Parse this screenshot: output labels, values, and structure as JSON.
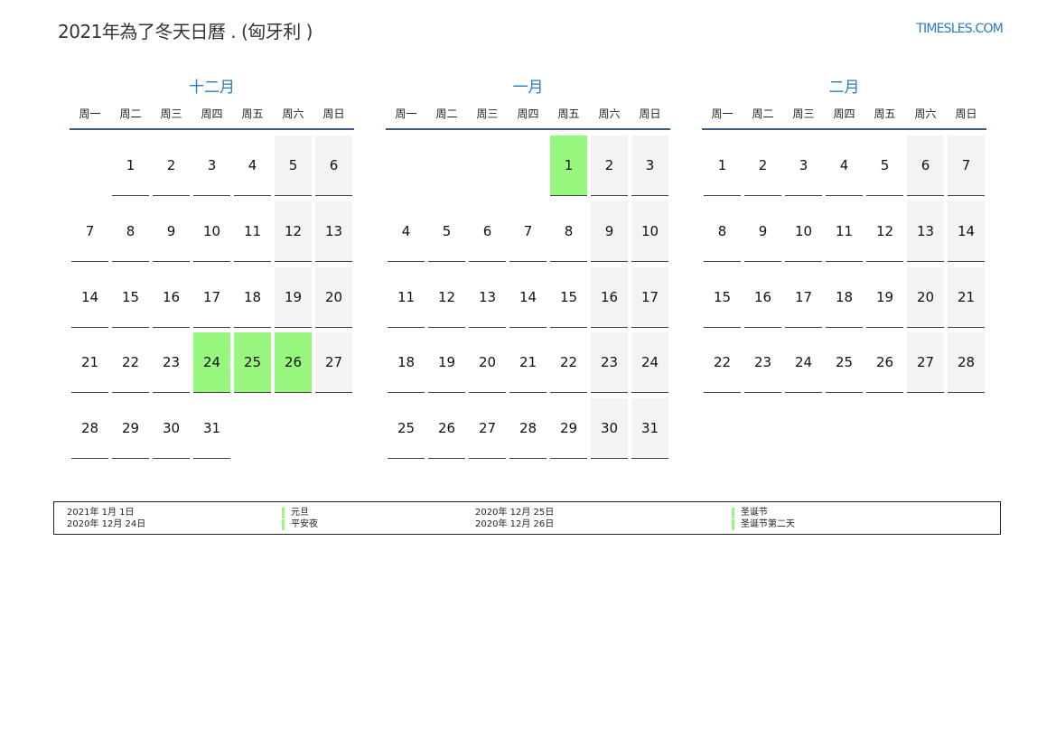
{
  "header": {
    "title": "2021年為了冬天日曆 . (匈牙利 )",
    "brand": "TIMESLES.COM"
  },
  "colors": {
    "accent": "#2a7ab8",
    "holiday": "#98f77f",
    "weekend": "#f3f3f3",
    "rule": "#3b5a82"
  },
  "weekdays": [
    "周一",
    "周二",
    "周三",
    "周四",
    "周五",
    "周六",
    "周日"
  ],
  "months": [
    {
      "name": "十二月",
      "weeks": [
        [
          null,
          "1",
          "2",
          "3",
          "4",
          "5",
          "6"
        ],
        [
          "7",
          "8",
          "9",
          "10",
          "11",
          "12",
          "13"
        ],
        [
          "14",
          "15",
          "16",
          "17",
          "18",
          "19",
          "20"
        ],
        [
          "21",
          "22",
          "23",
          "24",
          "25",
          "26",
          "27"
        ],
        [
          "28",
          "29",
          "30",
          "31",
          null,
          null,
          null
        ]
      ],
      "holidays": [
        "24",
        "25",
        "26"
      ]
    },
    {
      "name": "一月",
      "weeks": [
        [
          null,
          null,
          null,
          null,
          "1",
          "2",
          "3"
        ],
        [
          "4",
          "5",
          "6",
          "7",
          "8",
          "9",
          "10"
        ],
        [
          "11",
          "12",
          "13",
          "14",
          "15",
          "16",
          "17"
        ],
        [
          "18",
          "19",
          "20",
          "21",
          "22",
          "23",
          "24"
        ],
        [
          "25",
          "26",
          "27",
          "28",
          "29",
          "30",
          "31"
        ]
      ],
      "holidays": [
        "1"
      ]
    },
    {
      "name": "二月",
      "weeks": [
        [
          "1",
          "2",
          "3",
          "4",
          "5",
          "6",
          "7"
        ],
        [
          "8",
          "9",
          "10",
          "11",
          "12",
          "13",
          "14"
        ],
        [
          "15",
          "16",
          "17",
          "18",
          "19",
          "20",
          "21"
        ],
        [
          "22",
          "23",
          "24",
          "25",
          "26",
          "27",
          "28"
        ]
      ],
      "holidays": []
    }
  ],
  "legend": {
    "items": [
      {
        "date": "2021年 1月 1日",
        "name": "元旦"
      },
      {
        "date": "2020年 12月 24日",
        "name": "平安夜"
      },
      {
        "date": "2020年 12月 25日",
        "name": "圣诞节"
      },
      {
        "date": "2020年 12月 26日",
        "name": "圣诞节第二天"
      }
    ]
  }
}
